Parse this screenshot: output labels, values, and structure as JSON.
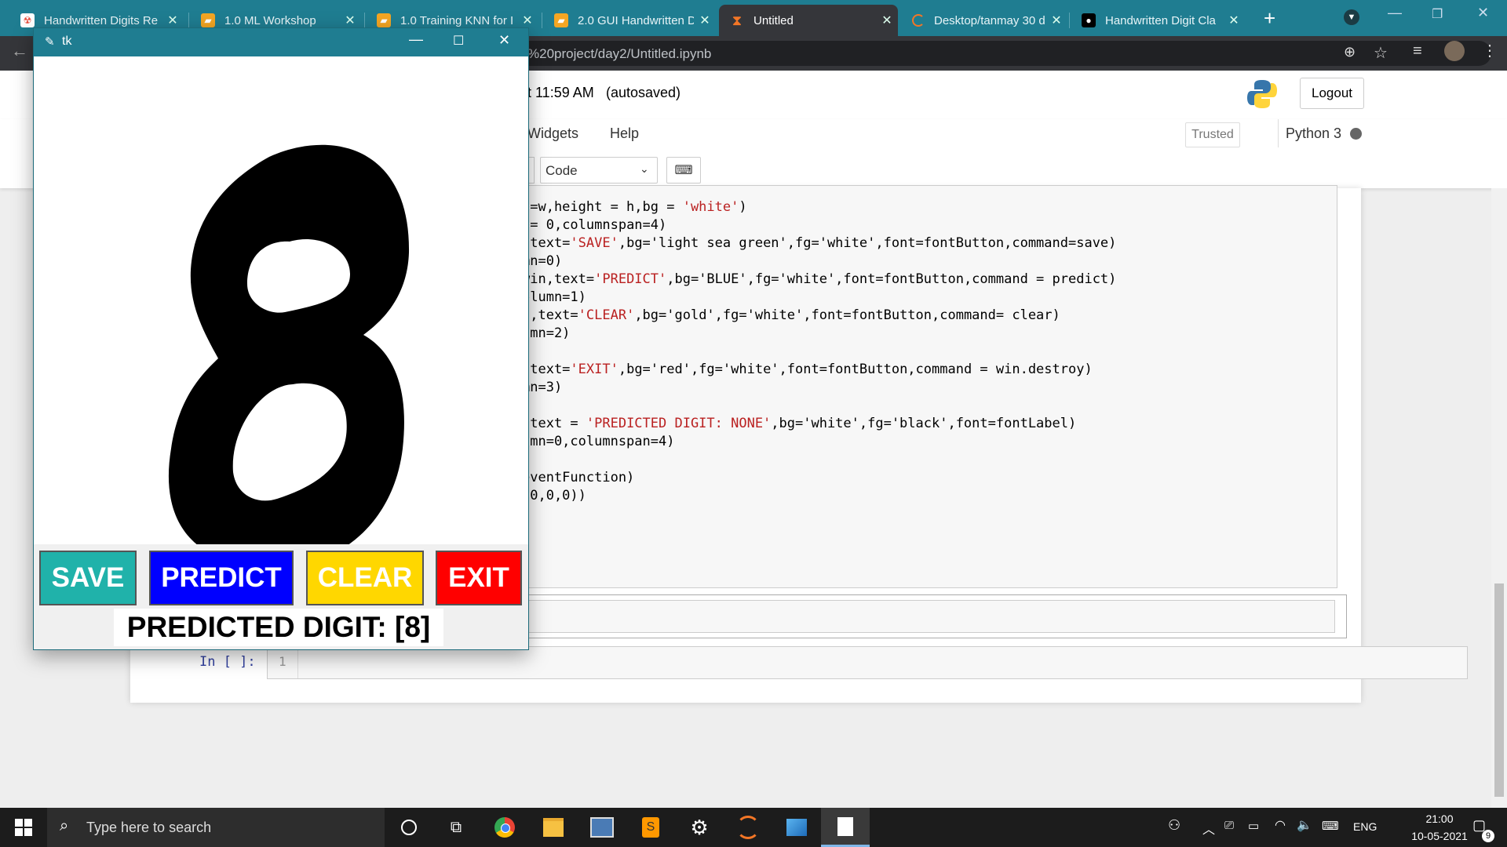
{
  "browser": {
    "tabs": [
      {
        "title": "Handwritten Digits Re",
        "fav_color": "#e74c3c"
      },
      {
        "title": "1.0 ML Workshop",
        "fav_color": "#f4a623"
      },
      {
        "title": "1.0 Training KNN for I",
        "fav_color": "#f4a623"
      },
      {
        "title": "2.0 GUI Handwritten D",
        "fav_color": "#f4a623"
      },
      {
        "title": "Untitled",
        "fav_color": "#f37626"
      },
      {
        "title": "Desktop/tanmay 30 d",
        "fav_color": "#f37626"
      },
      {
        "title": "Handwritten Digit Cla",
        "fav_color": "#000000"
      }
    ],
    "url_fragment": "%20project/day2/Untitled.ipynb"
  },
  "jupyter": {
    "checkpoint": "t 11:59 AM",
    "autosaved": "(autosaved)",
    "logout": "Logout",
    "menu_widgets": "Widgets",
    "menu_help": "Help",
    "trusted": "Trusted",
    "kernel": "Python 3",
    "cell_type": "Code",
    "prompt": "In [ ]:",
    "line_no": "1"
  },
  "code_lines": [
    {
      "a": "h=w,height = h,bg = ",
      "b": "'white'",
      "c": ")"
    },
    {
      "a": " = ",
      "b": "",
      "c": "0,columnspan=4)"
    },
    {
      "a": " text=",
      "b": "'SAVE'",
      "c": ",bg='light sea green',fg='white',font=fontButton,command=save)"
    },
    {
      "a": "mn=0)",
      "b": "",
      "c": ""
    },
    {
      "a": "win,text=",
      "b": "'PREDICT'",
      "c": ",bg='BLUE',fg='white',font=fontButton,command = predict)"
    },
    {
      "a": "olumn=1)",
      "b": "",
      "c": ""
    },
    {
      "a": "),text=",
      "b": "'CLEAR'",
      "c": ",bg='gold',fg='white',font=fontButton,command= clear)"
    },
    {
      "a": "umn=2)",
      "b": "",
      "c": ""
    },
    {
      "a": "",
      "b": "",
      "c": ""
    },
    {
      "a": " text=",
      "b": "'EXIT'",
      "c": ",bg='red',fg='white',font=fontButton,command = win.destroy)"
    },
    {
      "a": "mn=3)",
      "b": "",
      "c": ""
    },
    {
      "a": "",
      "b": "",
      "c": ""
    },
    {
      "a": " text = ",
      "b": "'PREDICTED DIGIT: NONE'",
      "c": ",bg='white',fg='black',font=fontLabel)"
    },
    {
      "a": "umn=0,columnspan=4)",
      "b": "",
      "c": ""
    },
    {
      "a": "",
      "b": "",
      "c": ""
    },
    {
      "a": "eventFunction)",
      "b": "",
      "c": ""
    },
    {
      "a": "(0,0,0))",
      "b": "",
      "c": ""
    }
  ],
  "tk": {
    "title": "tk",
    "buttons": {
      "save": "SAVE",
      "predict": "PREDICT",
      "clear": "CLEAR",
      "exit": "EXIT"
    },
    "prediction": "PREDICTED DIGIT: [8]",
    "colors": {
      "save": "#20b2aa",
      "predict": "#0000ff",
      "clear": "#ffd700",
      "exit": "#ff0000"
    }
  },
  "taskbar": {
    "search_placeholder": "Type here to search",
    "lang": "ENG",
    "time": "21:00",
    "date": "10-05-2021",
    "notif_count": "9"
  }
}
